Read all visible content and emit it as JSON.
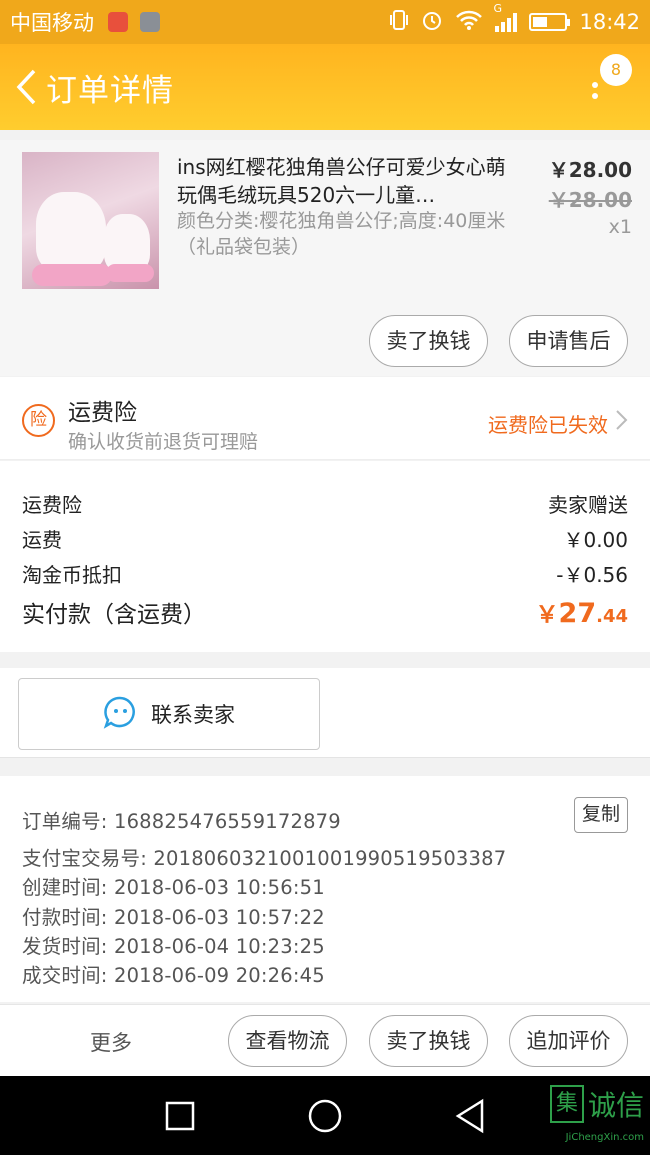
{
  "status_bar": {
    "carrier": "中国移动",
    "time": "18:42",
    "network": "G",
    "battery_level": 0.45
  },
  "nav": {
    "title": "订单详情",
    "badge_count": "8"
  },
  "product": {
    "title": "ins网红樱花独角兽公仔可爱少女心萌玩偶毛绒玩具520六一儿童…",
    "sku": "颜色分类:樱花独角兽公仔;高度:40厘米（礼品袋包装）",
    "price": "￥28.00",
    "original_price": "￥28.00",
    "quantity": "x1",
    "btn_resell": "卖了换钱",
    "btn_after_sale": "申请售后"
  },
  "insurance": {
    "icon_text": "险",
    "title": "运费险",
    "desc": "确认收货前退货可理赔",
    "status": "运费险已失效",
    "status_color": "#f06a1e"
  },
  "costs": {
    "rows": [
      {
        "label": "运费险",
        "value": "卖家赠送"
      },
      {
        "label": "运费",
        "value": "￥0.00"
      },
      {
        "label": "淘金币抵扣",
        "value": "-￥0.56"
      }
    ],
    "total_label": "实付款（含运费）",
    "total_currency": "￥",
    "total_int": "27",
    "total_dec": ".44"
  },
  "contact": {
    "label": "联系卖家"
  },
  "order_info": {
    "lines": [
      "订单编号: 168825476559172879",
      "支付宝交易号: 2018060321001001990519503387",
      "创建时间: 2018-06-03 10:56:51",
      "付款时间: 2018-06-03 10:57:22",
      "发货时间: 2018-06-04 10:23:25",
      "成交时间: 2018-06-09 20:26:45"
    ],
    "copy_label": "复制"
  },
  "actions": {
    "more": "更多",
    "logistics": "查看物流",
    "resell": "卖了换钱",
    "review": "追加评价"
  },
  "watermark": {
    "box_char": "集",
    "text": "诚信",
    "sub": "JiChengXin.com"
  },
  "colors": {
    "brand": "#ffb41f",
    "accent": "#f06a1e"
  }
}
